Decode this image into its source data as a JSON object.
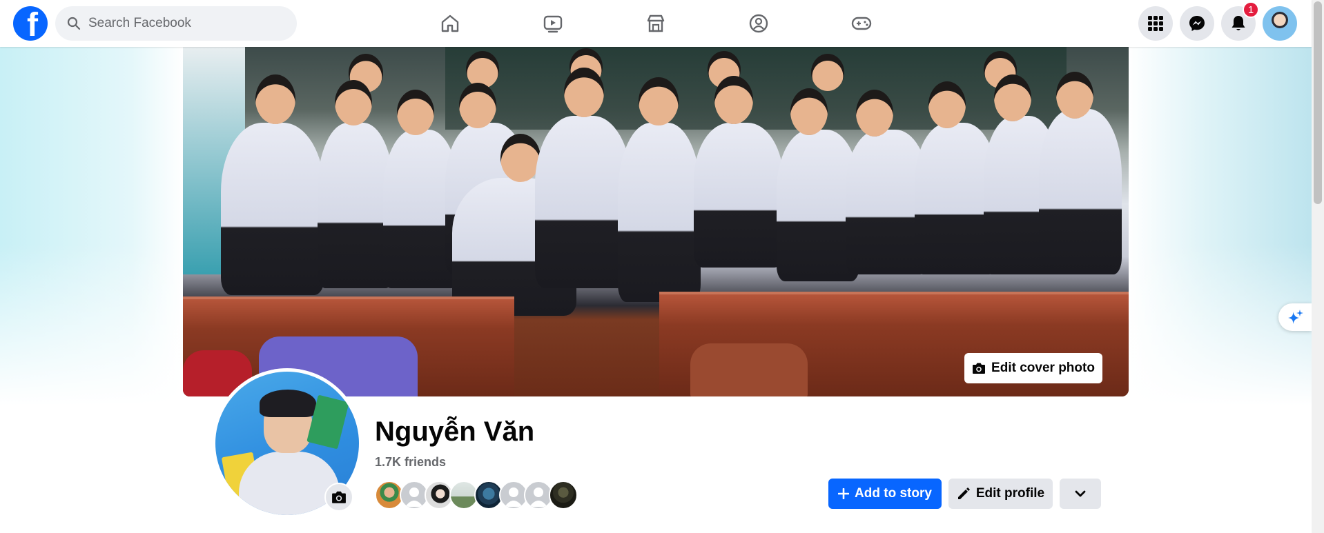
{
  "topbar": {
    "logo_letter": "f",
    "search": {
      "placeholder": "Search Facebook",
      "value": ""
    },
    "nav_icons": [
      "home-icon",
      "watch-icon",
      "marketplace-icon",
      "groups-icon",
      "gaming-icon"
    ],
    "right_icons": [
      "menu-grid-icon",
      "messenger-icon",
      "notifications-icon"
    ],
    "notification_count": "1"
  },
  "cover": {
    "edit_label": "Edit cover photo"
  },
  "profile": {
    "name": "Nguyễn Văn",
    "friends": "1.7K friends",
    "friend_avatar_count": 8
  },
  "actions": {
    "add_story_label": "Add to story",
    "edit_profile_label": "Edit profile"
  },
  "colors": {
    "brand": "#0866ff",
    "badge": "#e41e3f",
    "secondary_button": "#e4e6eb",
    "muted_text": "#65676b"
  }
}
